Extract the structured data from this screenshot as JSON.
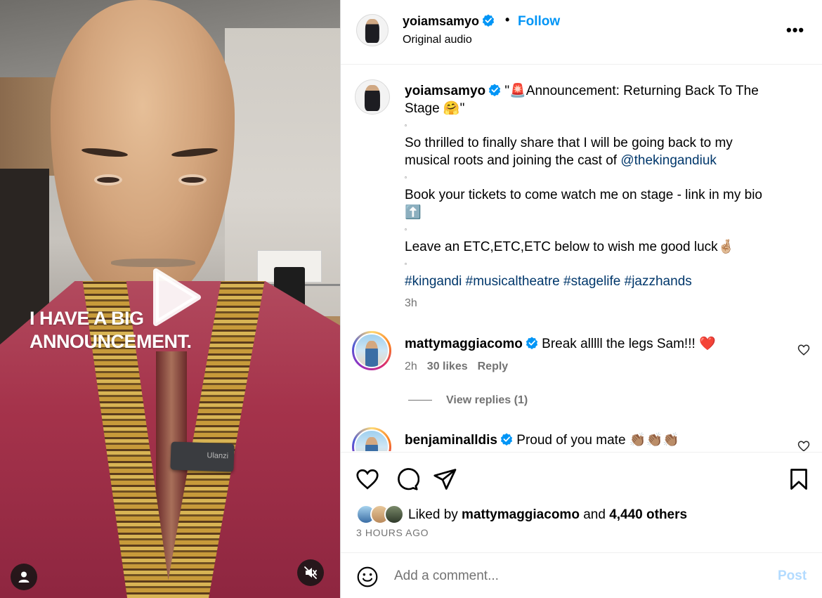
{
  "video": {
    "overlay_line1": "I HAVE A BIG",
    "overlay_line2": "ANNOUNCEMENT.",
    "mic_label": "Ulanzi"
  },
  "header": {
    "username": "yoiamsamyo",
    "separator": "•",
    "follow_label": "Follow",
    "subtitle": "Original audio",
    "more_label": "•••"
  },
  "caption": {
    "username": "yoiamsamyo",
    "line1": "\"🚨Announcement: Returning Back To The",
    "line2": "Stage 🤗\"",
    "sep": "▫",
    "para1a": "So thrilled to finally share that I will be going back to my",
    "para1b": "musical roots and joining the cast of ",
    "mention": "@thekingandiuk",
    "para2": "Book your tickets to come watch me on stage - link in my bio",
    "para2_emoji": "⬆️",
    "para3": "Leave an ETC,ETC,ETC below to wish me good luck🤞🏼",
    "hashtags": "#kingandi #musicaltheatre #stagelife #jazzhands",
    "time": "3h"
  },
  "comments": [
    {
      "username": "mattymaggiacomo",
      "text": "Break alllll the legs Sam!!! ❤️",
      "time": "2h",
      "likes": "30 likes",
      "reply_label": "Reply",
      "view_replies": "View replies (1)"
    },
    {
      "username": "benjaminalldis",
      "text": "Proud of you mate 👏🏽👏🏽👏🏽"
    }
  ],
  "actions": {
    "liked_prefix": "Liked by ",
    "liked_user": "mattymaggiacomo",
    "liked_and": " and ",
    "liked_others": "4,440 others",
    "hours_ago": "3 HOURS AGO"
  },
  "add_comment": {
    "placeholder": "Add a comment...",
    "post_label": "Post"
  },
  "colors": {
    "accent": "#0095f6",
    "link": "#00376b",
    "muted": "#737373",
    "post_disabled": "#b3dbff"
  },
  "icons": [
    "play-icon",
    "user-icon",
    "mute-icon",
    "verified-icon",
    "more-icon",
    "heart-icon",
    "comment-icon",
    "share-icon",
    "bookmark-icon",
    "emoji-icon"
  ]
}
